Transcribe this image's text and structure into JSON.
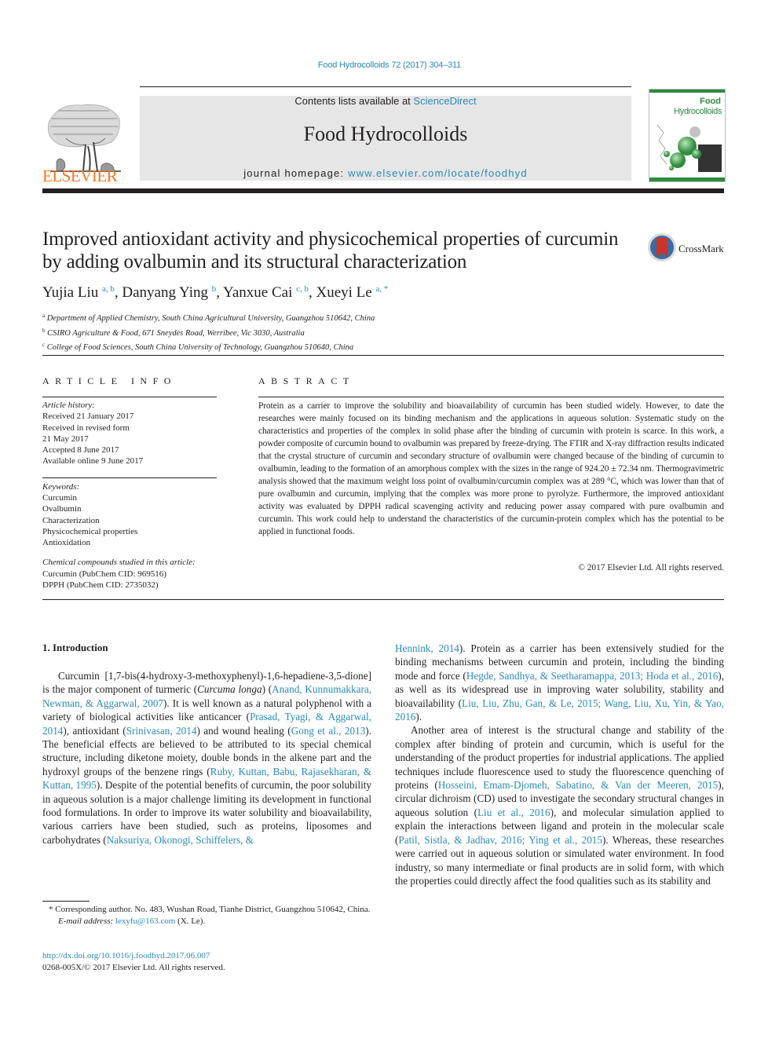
{
  "header": {
    "journal_ref": "Food Hydrocolloids 72 (2017) 304–311",
    "contents_prefix": "Contents lists available at ",
    "contents_link": "ScienceDirect",
    "journal_title": "Food Hydrocolloids",
    "homepage_prefix": "journal homepage: ",
    "homepage_link": "www.elsevier.com/locate/foodhyd",
    "publisher": "ELSEVIER",
    "cover_title_line1": "Food",
    "cover_title_line2": "Hydrocolloids",
    "colors": {
      "link": "#2a8ab7",
      "elsevier_orange": "#f47920",
      "cover_green": "#2e8b3e"
    }
  },
  "article": {
    "title": "Improved antioxidant activity and physicochemical properties of curcumin by adding ovalbumin and its structural characterization",
    "crossmark_label": "CrossMark",
    "authors": [
      {
        "name": "Yujia Liu",
        "sup": "a, b",
        "sep": ", "
      },
      {
        "name": "Danyang Ying",
        "sup": "b",
        "sep": ", "
      },
      {
        "name": "Yanxue Cai",
        "sup": "c, b",
        "sep": ", "
      },
      {
        "name": "Xueyi Le",
        "sup": "a, *",
        "sep": ""
      }
    ],
    "affiliations": [
      {
        "mark": "a",
        "text": "Department of Applied Chemistry, South China Agricultural University, Guangzhou 510642, China"
      },
      {
        "mark": "b",
        "text": "CSIRO Agriculture & Food, 671 Sneydes Road, Werribee, Vic 3030, Australia"
      },
      {
        "mark": "c",
        "text": "College of Food Sciences, South China University of Technology, Guangzhou 510640, China"
      }
    ]
  },
  "article_info": {
    "heading": "ARTICLE INFO",
    "history_label": "Article history:",
    "history": [
      "Received 21 January 2017",
      "Received in revised form",
      "21 May 2017",
      "Accepted 8 June 2017",
      "Available online 9 June 2017"
    ],
    "keywords_label": "Keywords:",
    "keywords": [
      "Curcumin",
      "Ovalbumin",
      "Characterization",
      "Physicochemical properties",
      "Antioxidation"
    ],
    "compounds_label": "Chemical compounds studied in this article:",
    "compounds": [
      "Curcumin (PubChem CID: 969516)",
      "DPPH (PubChem CID: 2735032)"
    ]
  },
  "abstract": {
    "heading": "ABSTRACT",
    "text": "Protein as a carrier to improve the solubility and bioavailability of curcumin has been studied widely. However, to date the researches were mainly focused on its binding mechanism and the applications in aqueous solution. Systematic study on the characteristics and properties of the complex in solid phase after the binding of curcumin with protein is scarce. In this work, a powder composite of curcumin bound to ovalbumin was prepared by freeze-drying. The FTIR and X-ray diffraction results indicated that the crystal structure of curcumin and secondary structure of ovalbumin were changed because of the binding of curcumin to ovalbumin, leading to the formation of an amorphous complex with the sizes in the range of 924.20 ± 72.34 nm. Thermogravimetric analysis showed that the maximum weight loss point of ovalbumin/curcumin complex was at 289 °C, which was lower than that of pure ovalbumin and curcumin, implying that the complex was more prone to pyrolyze. Furthermore, the improved antioxidant activity was evaluated by DPPH radical scavenging activity and reducing power assay compared with pure ovalbumin and curcumin. This work could help to understand the characteristics of the curcumin-protein complex which has the potential to be applied in functional foods.",
    "copyright": "© 2017 Elsevier Ltd. All rights reserved."
  },
  "body": {
    "intro_heading": "1.  Introduction",
    "left_col": [
      {
        "t": "Curcumin [1,7-bis(4-hydroxy-3-methoxyphenyl)-1,6-hepadiene-3,5-dione] is the major component of turmeric ("
      },
      {
        "t": "Curcuma longa",
        "i": true
      },
      {
        "t": ") ("
      },
      {
        "t": "Anand, Kunnumakkara, Newman, & Aggarwal, 2007",
        "link": true
      },
      {
        "t": "). It is well known as a natural polyphenol with a variety of biological activities like anticancer ("
      },
      {
        "t": "Prasad, Tyagi, & Aggarwal, 2014",
        "link": true
      },
      {
        "t": "), antioxidant ("
      },
      {
        "t": "Srinivasan, 2014",
        "link": true
      },
      {
        "t": ") and wound healing ("
      },
      {
        "t": "Gong et al., 2013",
        "link": true
      },
      {
        "t": "). The beneficial effects are believed to be attributed to its special chemical structure, including diketone moiety, double bonds in the alkene part and the hydroxyl groups of the benzene rings ("
      },
      {
        "t": "Ruby, Kuttan, Babu, Rajasekharan, & Kuttan, 1995",
        "link": true
      },
      {
        "t": "). Despite of the potential benefits of curcumin, the poor solubility in aqueous solution is a major challenge limiting its development in functional food formulations. In order to improve its water solubility and bioavailability, various carriers have been studied, such as proteins, liposomes and carbohydrates ("
      },
      {
        "t": "Naksuriya, Okonogi, Schiffelers, &",
        "link": true
      }
    ],
    "right_col_p1": [
      {
        "t": "Hennink, 2014",
        "link": true
      },
      {
        "t": "). Protein as a carrier has been extensively studied for the binding mechanisms between curcumin and protein, including the binding mode and force ("
      },
      {
        "t": "Hegde, Sandhya, & Seetharamappa, 2013; Hoda et al., 2016",
        "link": true
      },
      {
        "t": "), as well as its widespread use in improving water solubility, stability and bioavailability ("
      },
      {
        "t": "Liu, Liu, Zhu, Gan, & Le, 2015; Wang, Liu, Xu, Yin, & Yao, 2016",
        "link": true
      },
      {
        "t": ")."
      }
    ],
    "right_col_p2": [
      {
        "t": "Another area of interest is the structural change and stability of the complex after binding of protein and curcumin, which is useful for the understanding of the product properties for industrial applications. The applied techniques include fluorescence used to study the fluorescence quenching of proteins ("
      },
      {
        "t": "Hosseini, Emam-Djomeh, Sabatino, & Van der Meeren, 2015",
        "link": true
      },
      {
        "t": "), circular dichroism (CD) used to investigate the secondary structural changes in aqueous solution ("
      },
      {
        "t": "Liu et al., 2016",
        "link": true
      },
      {
        "t": "), and molecular simulation applied to explain the interactions between ligand and protein in the molecular scale ("
      },
      {
        "t": "Patil, Sistla, & Jadhav, 2016; Ying et al., 2015",
        "link": true
      },
      {
        "t": "). Whereas, these researches were carried out in aqueous solution or simulated water environment. In food industry, so many intermediate or final products are in solid form, with which the properties could directly affect the food qualities such as its stability and"
      }
    ]
  },
  "footnote": {
    "corresponding": "* Corresponding author. No. 483, Wushan Road, Tianhe District, Guangzhou 510642, China.",
    "email_label": "E-mail address: ",
    "email": "lexyfu@163.com",
    "email_suffix": " (X. Le).",
    "doi": "http://dx.doi.org/10.1016/j.foodhyd.2017.06.007",
    "issn_line": "0268-005X/© 2017 Elsevier Ltd. All rights reserved."
  }
}
